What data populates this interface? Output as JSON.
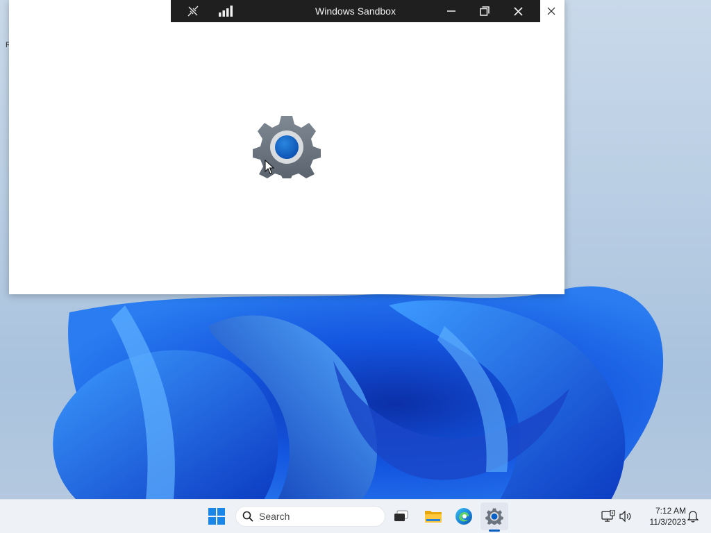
{
  "sandbox_bar": {
    "title": "Windows Sandbox",
    "icons": [
      "disconnect-icon",
      "signal-bars-icon",
      "minimize-icon",
      "restore-icon",
      "close-icon"
    ]
  },
  "app_window": {
    "splash_icon": "settings-gear-icon",
    "close_icon": "close-icon",
    "accent_color": "#0a5fc4"
  },
  "taskbar": {
    "start_icon": "windows-start-icon",
    "search_placeholder": "Search",
    "pinned": [
      "task-view-icon",
      "file-explorer-icon",
      "edge-icon",
      "settings-icon"
    ],
    "active_app": "settings-icon",
    "tray": {
      "icons": [
        "network-icon",
        "volume-icon",
        "notification-bell-icon"
      ],
      "time": "7:12 AM",
      "date": "11/3/2023"
    }
  },
  "desktop": {
    "glyph": "R"
  }
}
